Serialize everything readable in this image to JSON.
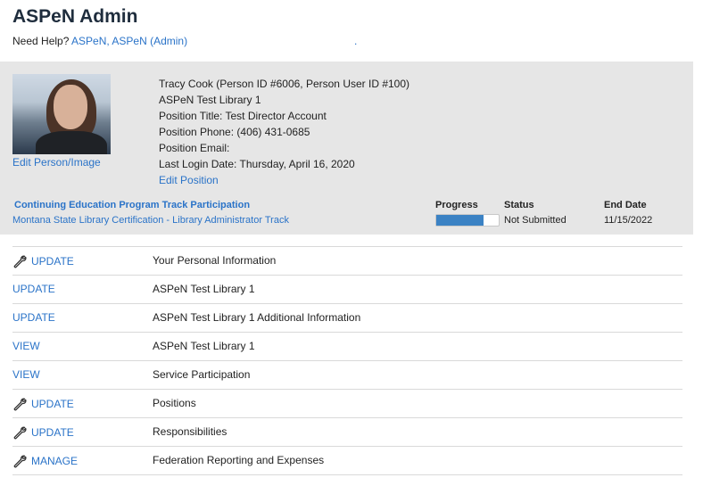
{
  "header": {
    "title": "ASPeN Admin",
    "help_prefix": "Need Help?",
    "help_link": "ASPeN, ASPeN (Admin)",
    "help_dot": "."
  },
  "profile": {
    "edit_person_link": "Edit Person/Image",
    "name_line": "Tracy Cook (Person ID #6006, Person User ID #100)",
    "library": "ASPeN Test Library 1",
    "position_title": "Position Title: Test Director Account",
    "position_phone": "Position Phone: (406) 431-0685",
    "position_email": "Position Email:",
    "last_login": "Last Login Date: Thursday, April 16, 2020",
    "edit_position_link": "Edit Position"
  },
  "continuing_education": {
    "section_title": "Continuing Education Program Track Participation",
    "track_link": "Montana State Library Certification - Library Administrator Track",
    "progress_header": "Progress",
    "status_header": "Status",
    "end_date_header": "End Date",
    "progress_fraction": 0.75,
    "status": "Not Submitted",
    "end_date": "11/15/2022",
    "colors": {
      "progress_fill": "#3b82c4"
    }
  },
  "actions": [
    {
      "action": "UPDATE",
      "has_icon": true,
      "icon": "wrench-icon",
      "description": "Your Personal Information"
    },
    {
      "action": "UPDATE",
      "has_icon": false,
      "description": "ASPeN Test Library 1"
    },
    {
      "action": "UPDATE",
      "has_icon": false,
      "description": "ASPeN Test Library 1 Additional Information"
    },
    {
      "action": "VIEW",
      "has_icon": false,
      "description": "ASPeN Test Library 1"
    },
    {
      "action": "VIEW",
      "has_icon": false,
      "description": "Service Participation"
    },
    {
      "action": "UPDATE",
      "has_icon": true,
      "icon": "wrench-icon",
      "description": "Positions"
    },
    {
      "action": "UPDATE",
      "has_icon": true,
      "icon": "wrench-icon",
      "description": "Responsibilities"
    },
    {
      "action": "MANAGE",
      "has_icon": true,
      "icon": "wrench-icon",
      "description": "Federation Reporting and Expenses"
    }
  ],
  "colors": {
    "link": "#2a73c8",
    "panel_bg": "#e6e6e6",
    "title": "#1f2d3d"
  }
}
